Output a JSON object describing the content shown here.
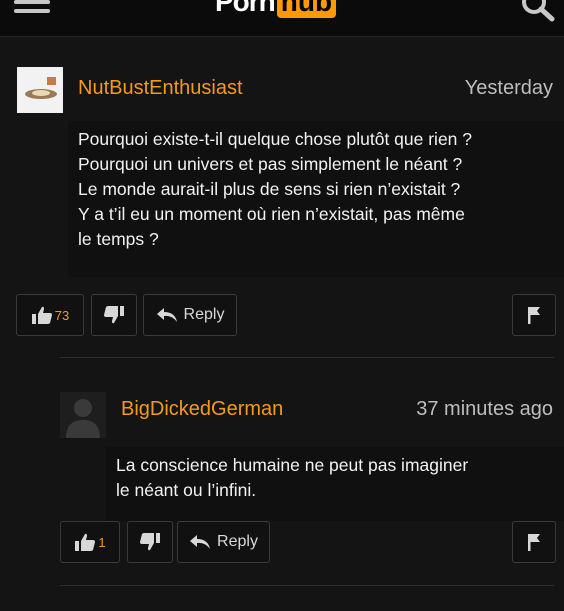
{
  "header": {
    "logo_text_a": "Porn",
    "logo_text_b": "hub"
  },
  "comments": [
    {
      "username": "NutBustEnthusiast",
      "timestamp": "Yesterday",
      "lines": [
        "Pourquoi existe-t-il quelque chose plutôt que rien ?",
        "Pourquoi un univers et pas simplement le néant ?",
        "Le monde aurait-il plus de sens si rien n’existait ?",
        "Y a t’il eu un moment où rien n’existait, pas même",
        "le temps ?"
      ],
      "likes": "73",
      "reply_label": "Reply"
    },
    {
      "username": "BigDickedGerman",
      "timestamp": "37 minutes ago",
      "lines": [
        "La conscience humaine ne peut pas imaginer",
        "le néant ou l’infini."
      ],
      "likes": "1",
      "reply_label": "Reply"
    }
  ],
  "colors": {
    "background": "#141414",
    "username": "#f59a1b",
    "accent": "#f90"
  },
  "icons": [
    "menu-icon",
    "search-icon",
    "thumbs-up-icon",
    "thumbs-down-icon",
    "reply-arrow-icon",
    "flag-icon"
  ]
}
